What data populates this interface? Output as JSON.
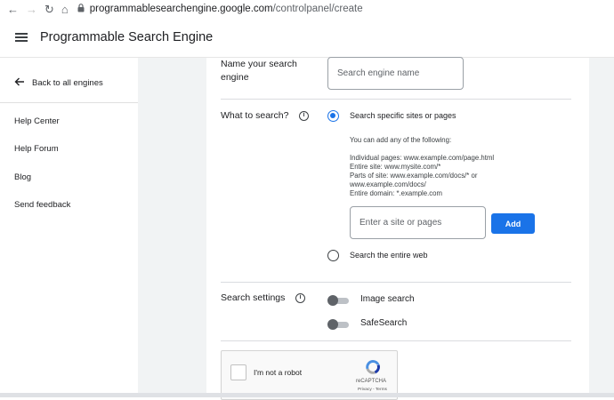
{
  "browser": {
    "url_host": "programmablesearchengine.google.com",
    "url_path": "/controlpanel/create"
  },
  "app": {
    "title": "Programmable Search Engine"
  },
  "sidebar": {
    "back_label": "Back to all engines",
    "links": [
      "Help Center",
      "Help Forum",
      "Blog",
      "Send feedback"
    ]
  },
  "form": {
    "name_label_line1": "Name your search",
    "name_label_line2": "engine",
    "name_placeholder": "Search engine name",
    "what_label": "What to search?",
    "option_specific": "Search specific sites or pages",
    "help_intro": "You can add any of the following:",
    "help_lines": [
      "Individual pages: www.example.com/page.html",
      "Entire site: www.mysite.com/*",
      "Parts of site: www.example.com/docs/* or",
      "www.example.com/docs/",
      "Entire domain: *.example.com"
    ],
    "site_placeholder": "Enter a site or pages",
    "add_label": "Add",
    "option_entire_web": "Search the entire web",
    "settings_label": "Search settings",
    "image_search_label": "Image search",
    "safesearch_label": "SafeSearch",
    "selected_option": "specific",
    "image_search_on": false,
    "safesearch_on": false
  },
  "captcha": {
    "label": "I'm not a robot",
    "brand": "reCAPTCHA",
    "terms": "Privacy - Terms"
  },
  "colors": {
    "accent": "#1a73e8",
    "page_bg": "#f1f3f4"
  }
}
